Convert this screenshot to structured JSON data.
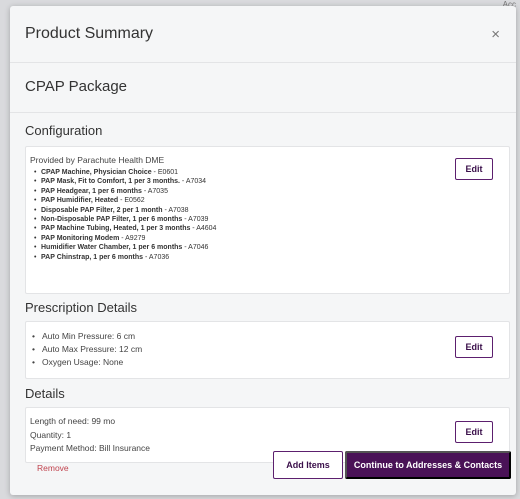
{
  "background": {
    "corner_text": "Acc"
  },
  "modal": {
    "title": "Product Summary",
    "close_glyph": "×",
    "package_title": "CPAP Package"
  },
  "configuration": {
    "section_title": "Configuration",
    "provider": "Provided by Parachute Health DME",
    "edit_label": "Edit",
    "items": [
      {
        "name": "CPAP Machine, Physician Choice",
        "code": " - E0601"
      },
      {
        "name": "PAP Mask, Fit to Comfort, 1 per 3 months.",
        "code": " - A7034"
      },
      {
        "name": "PAP Headgear, 1 per 6 months",
        "code": " - A7035"
      },
      {
        "name": "PAP Humidifier, Heated",
        "code": " - E0562"
      },
      {
        "name": "Disposable PAP Filter, 2 per 1 month",
        "code": " - A7038"
      },
      {
        "name": "Non-Disposable PAP Filter, 1 per 6 months",
        "code": " - A7039"
      },
      {
        "name": "PAP Machine Tubing, Heated, 1 per 3 months",
        "code": " - A4604"
      },
      {
        "name": "PAP Monitoring Modem",
        "code": " - A9279"
      },
      {
        "name": "Humidifier Water Chamber, 1 per 6 months",
        "code": " - A7046"
      },
      {
        "name": "PAP Chinstrap, 1 per 6 months",
        "code": " - A7036"
      }
    ]
  },
  "prescription": {
    "section_title": "Prescription Details",
    "edit_label": "Edit",
    "items": [
      "Auto Min Pressure: 6 cm",
      "Auto Max Pressure: 12 cm",
      "Oxygen Usage: None"
    ]
  },
  "details": {
    "section_title": "Details",
    "edit_label": "Edit",
    "length_of_need": "Length of need: 99 mo",
    "quantity": "Quantity: 1",
    "payment_method": "Payment Method: Bill Insurance"
  },
  "footer": {
    "remove_label": "Remove",
    "add_items_label": "Add Items",
    "continue_label": "Continue to Addresses & Contacts"
  },
  "colors": {
    "primary": "#4a1257",
    "danger": "#c1434e",
    "background": "#f5f6f7"
  }
}
